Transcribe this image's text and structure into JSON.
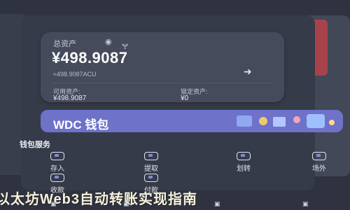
{
  "asset": {
    "total_label": "总资产",
    "hide_icon": "eye-icon",
    "hide_label": "🝖",
    "total_value": "¥498.9087",
    "sub_value": "≈498.9087ACU",
    "available_label": "可用资产:",
    "available_value": "¥498.9087",
    "locked_label": "锁定资产:",
    "locked_value": "¥0"
  },
  "wallet": {
    "title": "WDC 钱包",
    "subtitle": "",
    "banner_color": "#6e72c9"
  },
  "service": {
    "title": "钱包服务",
    "items": [
      {
        "label": "存入",
        "icon": "deposit-icon"
      },
      {
        "label": "提取",
        "icon": "withdraw-icon"
      },
      {
        "label": "划转",
        "icon": "transfer-icon"
      },
      {
        "label": "场外",
        "icon": "otc-icon"
      },
      {
        "label": "收款",
        "icon": "receive-icon"
      },
      {
        "label": "付款",
        "icon": "pay-icon"
      }
    ]
  },
  "headline": "以太坊Web3自动转账实现指南",
  "colors": {
    "background": "#2f3340",
    "card": "#454b5b",
    "accent": "#6e72c9",
    "alert": "#a8434b"
  }
}
